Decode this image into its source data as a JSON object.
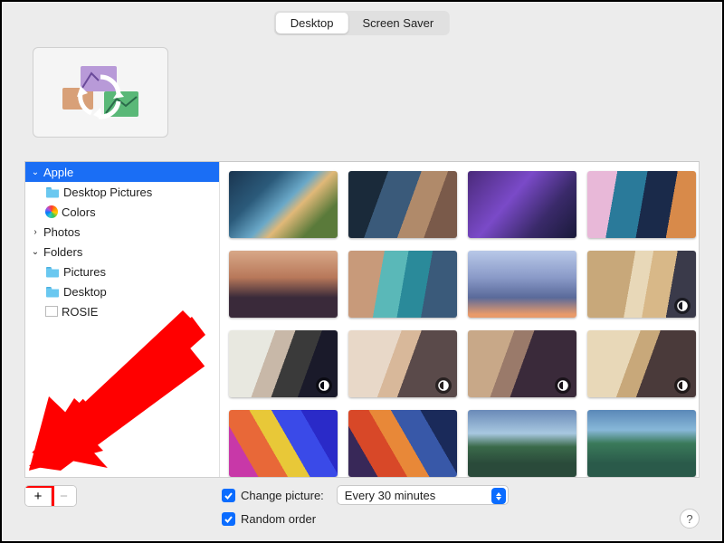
{
  "tabs": {
    "desktop": "Desktop",
    "screensaver": "Screen Saver"
  },
  "sidebar": {
    "apple": "Apple",
    "desktop_pictures": "Desktop Pictures",
    "colors": "Colors",
    "photos": "Photos",
    "folders": "Folders",
    "pictures": "Pictures",
    "desktop": "Desktop",
    "rosie": "ROSIE"
  },
  "buttons": {
    "add": "+",
    "remove": "−",
    "help": "?"
  },
  "options": {
    "change_picture_label": "Change picture:",
    "change_picture_value": "Every 30 minutes",
    "random_order_label": "Random order"
  }
}
